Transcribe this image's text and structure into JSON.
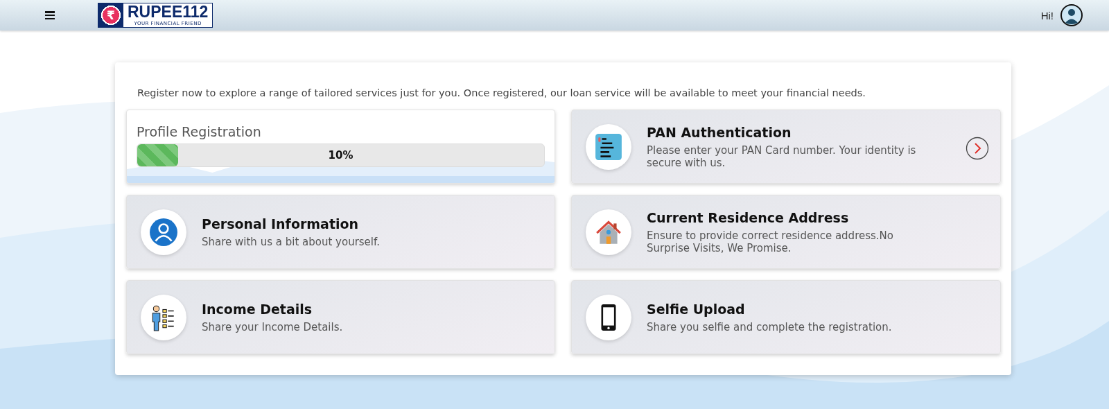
{
  "header": {
    "logo": {
      "symbol": "₹",
      "name": "RUPEE112",
      "tagline": "YOUR FINANCIAL FRIEND"
    },
    "greeting": "Hi!"
  },
  "intro": "Register now to explore a range of tailored services just for you. Once registered, our loan service will be available to meet your financial needs.",
  "steps": [
    {
      "kind": "progress",
      "title": "Profile Registration",
      "level": 0.1,
      "reading": "10%"
    },
    {
      "kind": "step",
      "title": "PAN Authentication",
      "description": "Please enter your PAN Card number. Your identity is secure with us.",
      "current": true
    },
    {
      "kind": "step",
      "title": "Personal Information",
      "description": "Share with us a bit about yourself.",
      "current": false
    },
    {
      "kind": "step",
      "title": "Current Residence Address",
      "description": "Ensure to provide correct residence address.No Surprise Visits, We Promise.",
      "current": false
    },
    {
      "kind": "step",
      "title": "Income Details",
      "description": "Share your Income Details.",
      "current": false
    },
    {
      "kind": "step",
      "title": "Selfie Upload",
      "description": "Share you selfie and complete the registration.",
      "current": false
    }
  ]
}
